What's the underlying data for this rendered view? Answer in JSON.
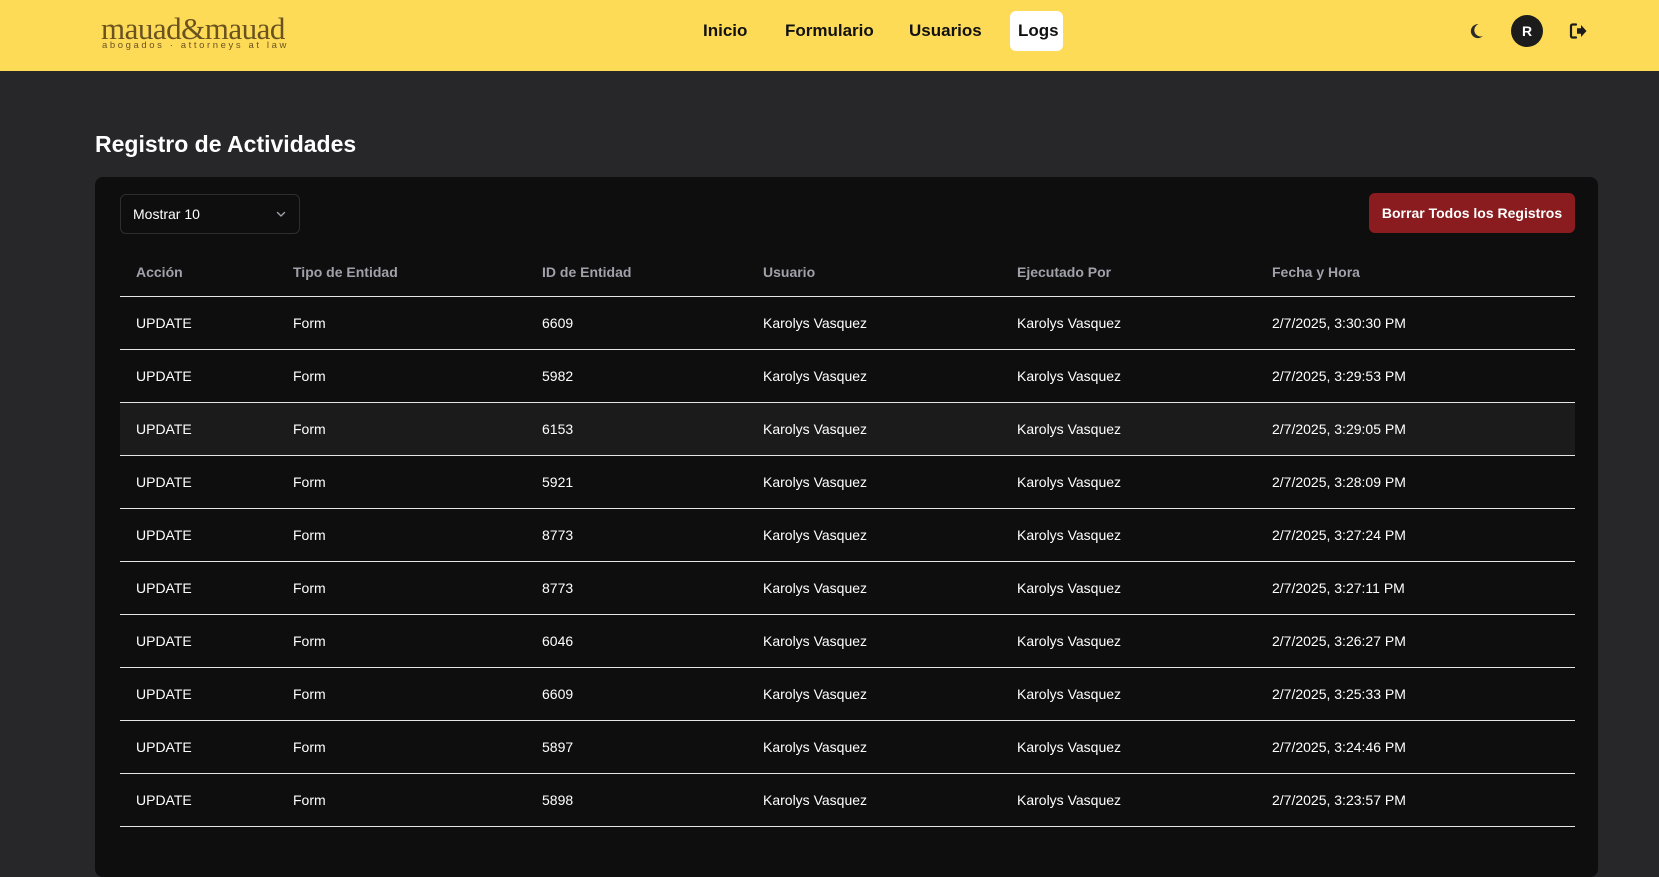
{
  "brand": {
    "logo_main": "mauad&mauad",
    "logo_sub": "abogados · attorneys at law",
    "color": "#6b5321"
  },
  "nav": {
    "items": [
      {
        "label": "Inicio"
      },
      {
        "label": "Formulario"
      },
      {
        "label": "Usuarios"
      },
      {
        "label": "Logs",
        "active": true
      }
    ]
  },
  "header_actions": {
    "theme_icon": "moon-icon",
    "avatar_initial": "R",
    "logout_icon": "logout-icon"
  },
  "page": {
    "title": "Registro de Actividades"
  },
  "controls": {
    "page_size_label": "Mostrar 10",
    "clear_button": "Borrar Todos los Registros"
  },
  "colors": {
    "header_bg": "#fedb56",
    "page_bg": "#27272a",
    "panel_bg": "#0e0e0f",
    "danger": "#8a1c1f"
  },
  "table": {
    "columns": [
      "Acción",
      "Tipo de Entidad",
      "ID de Entidad",
      "Usuario",
      "Ejecutado Por",
      "Fecha y Hora"
    ],
    "rows": [
      [
        "UPDATE",
        "Form",
        "6609",
        "Karolys Vasquez",
        "Karolys Vasquez",
        "2/7/2025, 3:30:30 PM"
      ],
      [
        "UPDATE",
        "Form",
        "5982",
        "Karolys Vasquez",
        "Karolys Vasquez",
        "2/7/2025, 3:29:53 PM"
      ],
      [
        "UPDATE",
        "Form",
        "6153",
        "Karolys Vasquez",
        "Karolys Vasquez",
        "2/7/2025, 3:29:05 PM"
      ],
      [
        "UPDATE",
        "Form",
        "5921",
        "Karolys Vasquez",
        "Karolys Vasquez",
        "2/7/2025, 3:28:09 PM"
      ],
      [
        "UPDATE",
        "Form",
        "8773",
        "Karolys Vasquez",
        "Karolys Vasquez",
        "2/7/2025, 3:27:24 PM"
      ],
      [
        "UPDATE",
        "Form",
        "8773",
        "Karolys Vasquez",
        "Karolys Vasquez",
        "2/7/2025, 3:27:11 PM"
      ],
      [
        "UPDATE",
        "Form",
        "6046",
        "Karolys Vasquez",
        "Karolys Vasquez",
        "2/7/2025, 3:26:27 PM"
      ],
      [
        "UPDATE",
        "Form",
        "6609",
        "Karolys Vasquez",
        "Karolys Vasquez",
        "2/7/2025, 3:25:33 PM"
      ],
      [
        "UPDATE",
        "Form",
        "5897",
        "Karolys Vasquez",
        "Karolys Vasquez",
        "2/7/2025, 3:24:46 PM"
      ],
      [
        "UPDATE",
        "Form",
        "5898",
        "Karolys Vasquez",
        "Karolys Vasquez",
        "2/7/2025, 3:23:57 PM"
      ]
    ]
  }
}
